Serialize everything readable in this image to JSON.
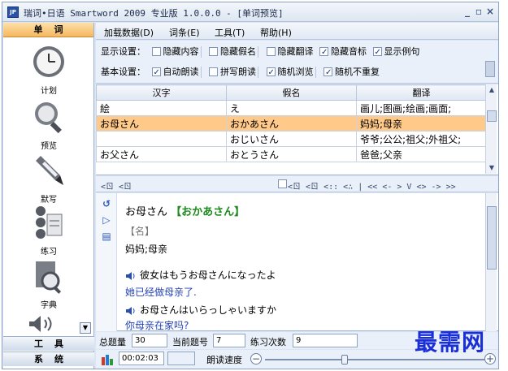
{
  "window": {
    "title": "瑞词•日语 Smartword 2009 专业版 1.0.0.0 - [单词预览]",
    "icon_text": "JP"
  },
  "nav": {
    "header": "单词",
    "items": [
      {
        "label": "计划",
        "icon": "clock-icon"
      },
      {
        "label": "预览",
        "icon": "magnifier-icon"
      },
      {
        "label": "默写",
        "icon": "pen-icon"
      },
      {
        "label": "练习",
        "icon": "practice-icon"
      },
      {
        "label": "字典",
        "icon": "dictionary-icon"
      }
    ],
    "tools": "工具",
    "system": "系统"
  },
  "menu": [
    "加载数据(D)",
    "词条(E)",
    "工具(T)",
    "帮助(H)"
  ],
  "settings": {
    "display_label": "显示设置：",
    "display_opts": [
      {
        "label": "隐藏内容",
        "checked": false
      },
      {
        "label": "隐藏假名",
        "checked": false
      },
      {
        "label": "隐藏翻译",
        "checked": false
      },
      {
        "label": "隐藏音标",
        "checked": true
      },
      {
        "label": "显示例句",
        "checked": true
      }
    ],
    "basic_label": "基本设置：",
    "basic_opts": [
      {
        "label": "自动朗读",
        "checked": true
      },
      {
        "label": "拼写朗读",
        "checked": false
      },
      {
        "label": "随机浏览",
        "checked": true
      },
      {
        "label": "随机不重复",
        "checked": true
      }
    ]
  },
  "table": {
    "headers": [
      "汉字",
      "假名",
      "翻译"
    ],
    "rows": [
      {
        "kanji": "絵",
        "kana": "え",
        "meaning": "画儿;图画;绘画;画面;",
        "selected": false
      },
      {
        "kanji": "お母さん",
        "kana": "おかあさん",
        "meaning": "妈妈;母亲",
        "selected": true
      },
      {
        "kanji": "",
        "kana": "おじいさん",
        "meaning": "爷爷;公公;祖父;外祖父;",
        "selected": false
      },
      {
        "kanji": "お父さん",
        "kana": "おとうさん",
        "meaning": "爸爸;父亲",
        "selected": false
      }
    ]
  },
  "toolbar2": {
    "left": "<ㄖ <ㄖ",
    "right": "<ㄖ <ㄖ <:: <∴ | << <- > V <> -> >>"
  },
  "detail": {
    "word": "お母さん",
    "reading": "【おかあさん】",
    "pos": "【名】",
    "meaning": "妈妈;母亲",
    "examples": [
      {
        "jp": "彼女はもうお母さんになったよ",
        "zh": "她已经做母亲了."
      },
      {
        "jp": "お母さんはいらっしゃいますか",
        "zh": "你母亲在家吗?"
      }
    ]
  },
  "status": {
    "total_label": "总题量",
    "total_value": "30",
    "current_label": "当前题号",
    "current_value": "7",
    "practice_label": "练习次数",
    "practice_value": "9",
    "time_value": "00:02:03",
    "speed_label": "朗读速度",
    "speed_level": 0.36
  },
  "watermark": "最需网",
  "colors": {
    "selected_row": "#ffc98a",
    "accent": "#2343b8",
    "kana": "#1c8a1c"
  }
}
